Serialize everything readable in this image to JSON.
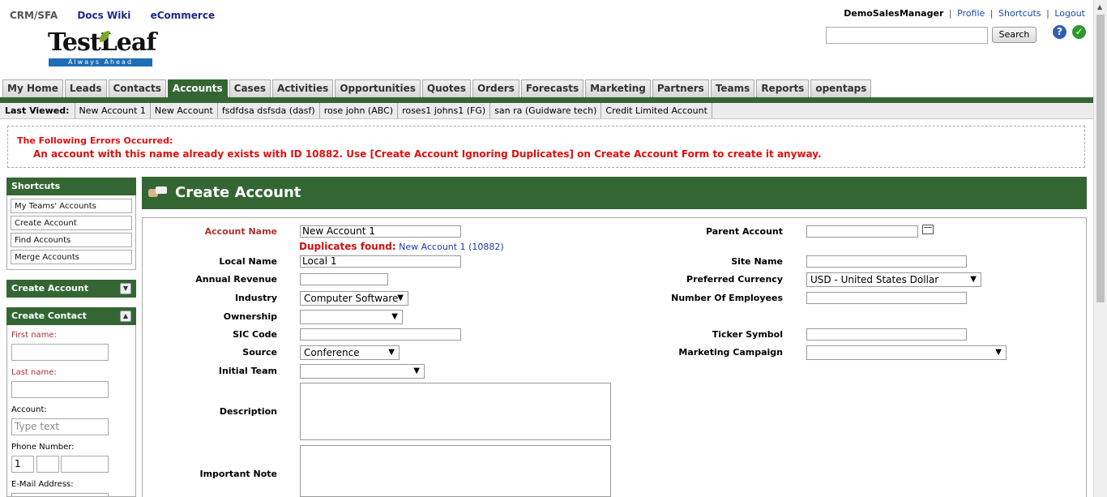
{
  "toplinks": {
    "crm": "CRM/SFA",
    "docs": "Docs Wiki",
    "ecommerce": "eCommerce"
  },
  "logo": {
    "word": "TestLeaf",
    "tagline": "Always Ahead"
  },
  "userbar": {
    "username": "DemoSalesManager",
    "profile": "Profile",
    "shortcuts": "Shortcuts",
    "logout": "Logout"
  },
  "search": {
    "button": "Search",
    "value": ""
  },
  "tabs": [
    "My Home",
    "Leads",
    "Contacts",
    "Accounts",
    "Cases",
    "Activities",
    "Opportunities",
    "Quotes",
    "Orders",
    "Forecasts",
    "Marketing",
    "Partners",
    "Teams",
    "Reports",
    "opentaps"
  ],
  "active_tab": "Accounts",
  "last_viewed": {
    "label": "Last Viewed:",
    "items": [
      "New Account 1",
      "New Account",
      "fsdfdsa dsfsda (dasf)",
      "rose john (ABC)",
      "roses1 johns1 (FG)",
      "san ra (Guidware tech)",
      "Credit Limited Account"
    ]
  },
  "errors": {
    "heading": "The Following Errors Occurred:",
    "message": "An account with this name already exists with ID 10882. Use [Create Account Ignoring Duplicates] on Create Account Form to create it anyway."
  },
  "sidebar": {
    "shortcuts_title": "Shortcuts",
    "shortcuts": [
      "My Teams' Accounts",
      "Create Account",
      "Find Accounts",
      "Merge Accounts"
    ],
    "create_account_title": "Create Account",
    "create_contact_title": "Create Contact",
    "contact_form": {
      "first_name": "First name:",
      "last_name": "Last name:",
      "account": "Account:",
      "account_placeholder": "Type text",
      "phone": "Phone Number:",
      "phone_country": "1",
      "email": "E-Mail Address:"
    }
  },
  "main": {
    "title": "Create Account",
    "fields": {
      "account_name_label": "Account Name",
      "account_name_value": "New Account 1",
      "duplicates_label": "Duplicates found:",
      "duplicates_link": "New Account 1 (10882)",
      "local_name_label": "Local Name",
      "local_name_value": "Local 1",
      "annual_revenue_label": "Annual Revenue",
      "industry_label": "Industry",
      "industry_value": "Computer Software",
      "ownership_label": "Ownership",
      "sic_code_label": "SIC Code",
      "source_label": "Source",
      "source_value": "Conference",
      "initial_team_label": "Initial Team",
      "description_label": "Description",
      "important_note_label": "Important Note",
      "parent_account_label": "Parent Account",
      "site_name_label": "Site Name",
      "preferred_currency_label": "Preferred Currency",
      "preferred_currency_value": "USD - United States Dollar",
      "num_employees_label": "Number Of Employees",
      "ticker_symbol_label": "Ticker Symbol",
      "marketing_campaign_label": "Marketing Campaign"
    }
  },
  "colors": {
    "brand_green": "#336633",
    "error_red": "#e01010",
    "link_blue": "#1a3aa8"
  }
}
